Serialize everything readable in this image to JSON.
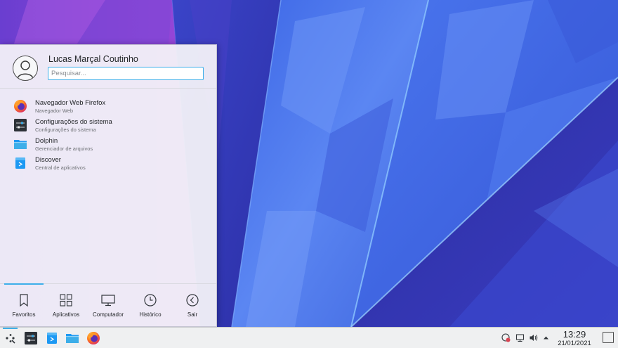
{
  "launcher": {
    "user_name": "Lucas Marçal Coutinho",
    "search_placeholder": "Pesquisar...",
    "apps": [
      {
        "name": "Navegador Web Firefox",
        "desc": "Navegador Web",
        "icon": "firefox-icon"
      },
      {
        "name": "Configurações do sistema",
        "desc": "Configurações do sistema",
        "icon": "system-settings-icon"
      },
      {
        "name": "Dolphin",
        "desc": "Gerenciador de arquivos",
        "icon": "folder-icon"
      },
      {
        "name": "Discover",
        "desc": "Central de aplicativos",
        "icon": "discover-icon"
      }
    ],
    "tabs": [
      {
        "label": "Favoritos",
        "icon": "bookmark-icon",
        "active": true
      },
      {
        "label": "Aplicativos",
        "icon": "grid-icon"
      },
      {
        "label": "Computador",
        "icon": "monitor-icon"
      },
      {
        "label": "Histórico",
        "icon": "clock-icon"
      },
      {
        "label": "Sair",
        "icon": "back-arrow-icon"
      }
    ]
  },
  "panel": {
    "tasks": [
      "app-launcher-icon",
      "system-settings-icon",
      "discover-icon",
      "folder-icon",
      "firefox-icon"
    ],
    "tray": [
      "updates-icon",
      "network-icon",
      "volume-icon",
      "tray-expand-icon"
    ],
    "clock": {
      "time": "13:29",
      "date": "21/01/2021"
    }
  },
  "colors": {
    "accent": "#3daee9",
    "panel_bg": "#eff0f1",
    "wallpaper_blue": "#3b4fd8",
    "wallpaper_purple": "#8a3fcf"
  }
}
